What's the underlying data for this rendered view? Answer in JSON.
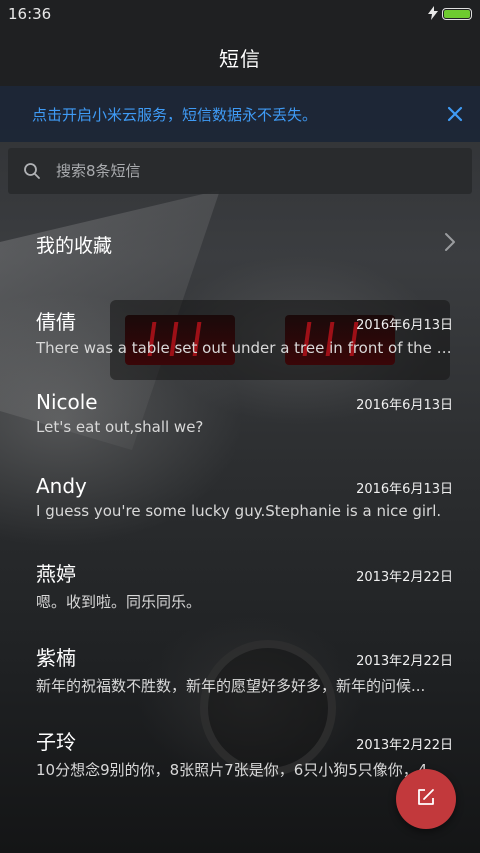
{
  "status_bar": {
    "time": "16:36",
    "battery_level": 1.0,
    "charging_icon": "lightning-icon",
    "battery_color": "#6ecb2f"
  },
  "header": {
    "title": "短信"
  },
  "cloud_banner": {
    "text": "点击开启小米云服务，短信数据永不丢失。",
    "text_color": "#3f9bf5",
    "close_icon": "close-icon"
  },
  "search": {
    "placeholder": "搜索8条短信",
    "icon": "search-icon"
  },
  "favorites": {
    "label": "我的收藏",
    "icon": "chevron-right-icon"
  },
  "conversations": [
    {
      "name": "倩倩",
      "date": "2016年6月13日",
      "preview": "There was a table set out under a tree in front of the ho..."
    },
    {
      "name": "Nicole",
      "date": "2016年6月13日",
      "preview": "Let's eat out,shall we?"
    },
    {
      "name": "Andy",
      "date": "2016年6月13日",
      "preview": "I guess you're some lucky guy.Stephanie is a nice girl."
    },
    {
      "name": "燕婷",
      "date": "2013年2月22日",
      "preview": "嗯。收到啦。同乐同乐。"
    },
    {
      "name": "紫楠",
      "date": "2013年2月22日",
      "preview": "新年的祝福数不胜数，新年的愿望好多好多，新年的问候..."
    },
    {
      "name": "子玲",
      "date": "2013年2月22日",
      "preview": "10分想念9别的你，8张照片7张是你，6只小狗5只像你，4..."
    }
  ],
  "compose_button": {
    "icon": "compose-icon",
    "color": "#c2393c"
  }
}
